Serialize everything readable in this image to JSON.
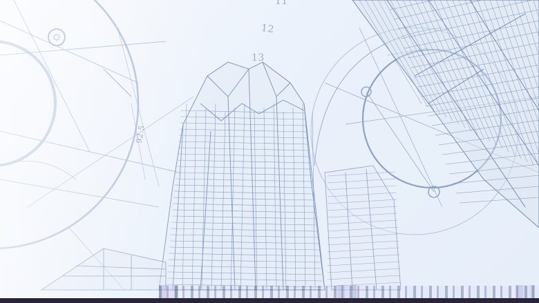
{
  "scene": {
    "subject": "architectural-wireframe-skyscrapers",
    "palette": {
      "background": "#eef3fa",
      "line": "#8fa3c4",
      "line_dark": "#5f7498",
      "bottom_bar": "#2a2438"
    }
  },
  "annotations": {
    "dim_12": "12",
    "dim_11": "11",
    "dim_13": "13",
    "dim_left": "92.5"
  }
}
